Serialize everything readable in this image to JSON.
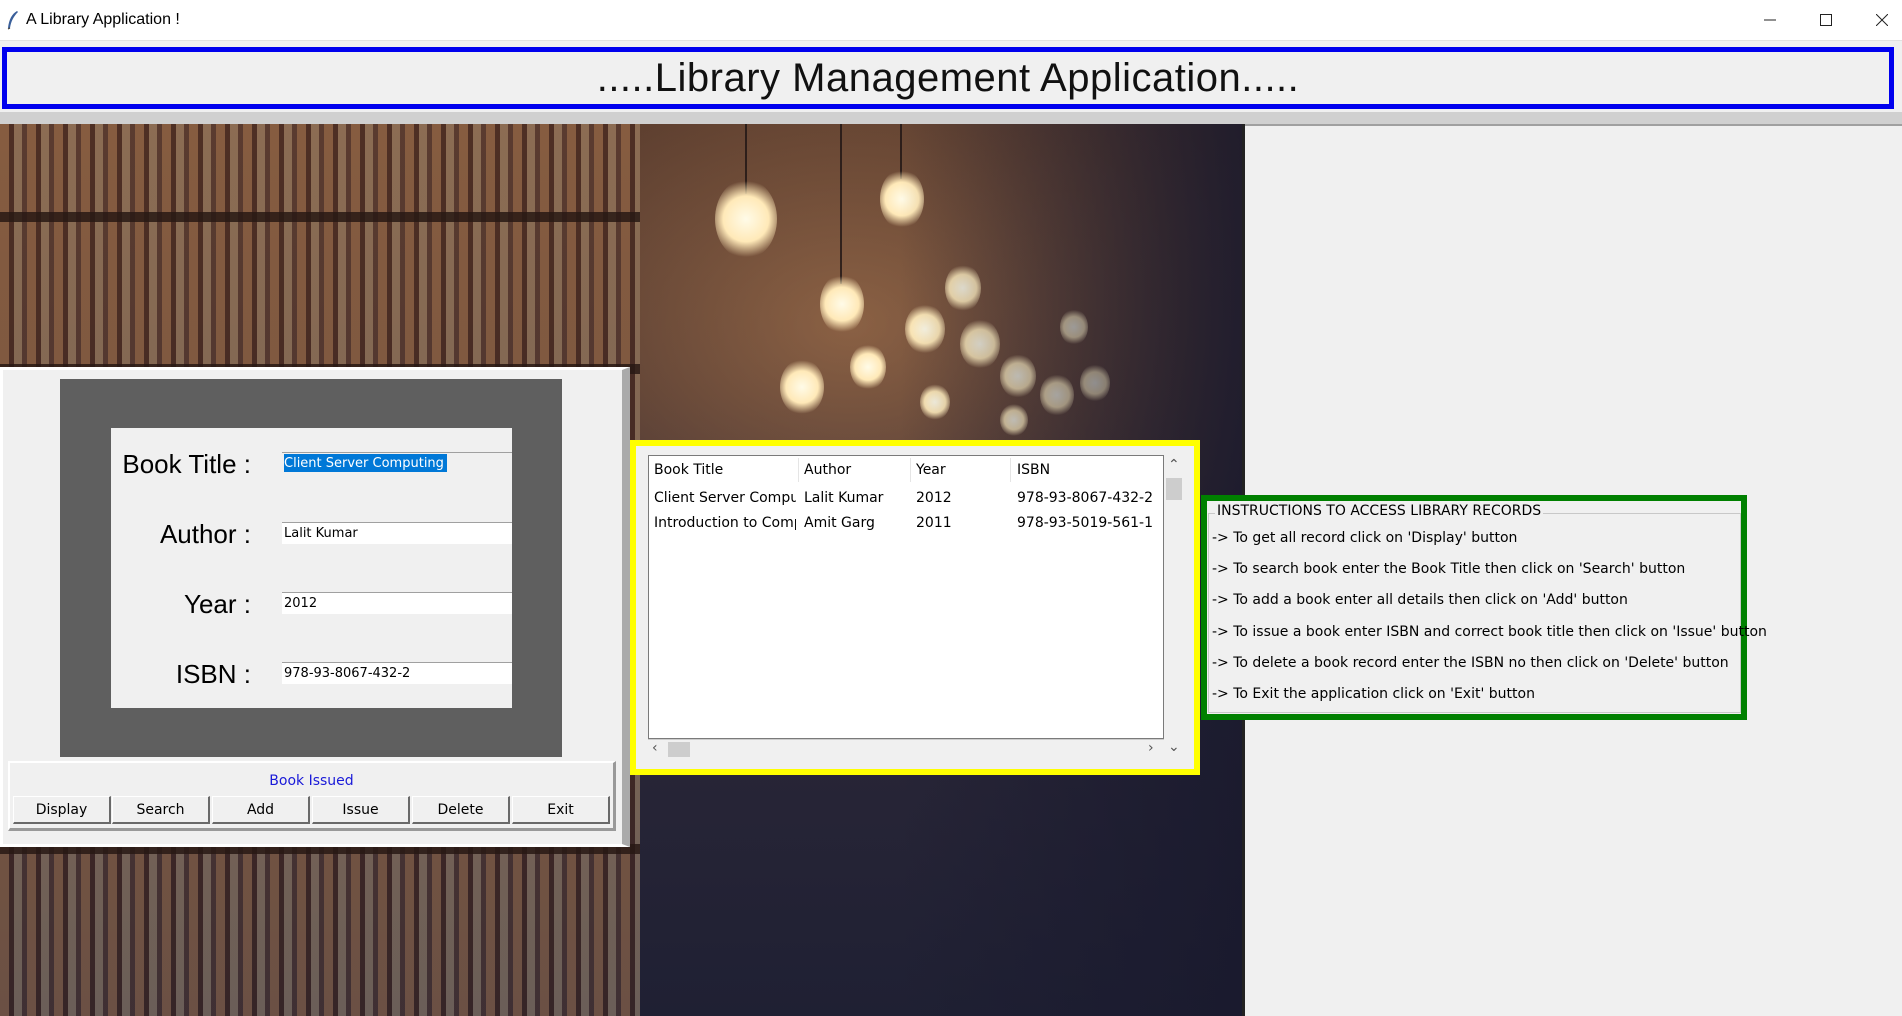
{
  "window": {
    "title": "A Library Application !",
    "icon": "feather-icon"
  },
  "header": {
    "title": ".....Library Management Application....."
  },
  "form": {
    "title_label": "Book Title :",
    "author_label": "Author :",
    "year_label": "Year :",
    "isbn_label": "ISBN :",
    "title_value": "Client Server Computing",
    "author_value": "Lalit Kumar",
    "year_value": "2012",
    "isbn_value": "978-93-8067-432-2"
  },
  "status": {
    "text": "Book Issued",
    "color": "#1a1ad8"
  },
  "buttons": {
    "display": "Display",
    "search": "Search",
    "add": "Add",
    "issue": "Issue",
    "delete": "Delete",
    "exit": "Exit"
  },
  "table": {
    "columns": [
      "Book Title",
      "Author",
      "Year",
      "ISBN"
    ],
    "rows": [
      [
        "Client Server Computing",
        "Lalit Kumar",
        "2012",
        "978-93-8067-432-2"
      ],
      [
        "Introduction to Computing",
        "Amit Garg",
        "2011",
        "978-93-5019-561-1"
      ]
    ]
  },
  "instructions": {
    "title": "INSTRUCTIONS TO ACCESS LIBRARY RECORDS",
    "lines": [
      "-> To get all record click on 'Display' button",
      "-> To search book enter the Book Title then click on 'Search' button",
      "-> To add a book enter all details then click on 'Add' button",
      "-> To issue a book enter ISBN and correct book title then click on 'Issue' button",
      "-> To delete a book record enter the ISBN no then click on 'Delete' button",
      "-> To Exit the application click on 'Exit' button"
    ]
  },
  "colors": {
    "header_border": "#0000ee",
    "table_border": "#ffff00",
    "instructions_border": "#008000"
  }
}
